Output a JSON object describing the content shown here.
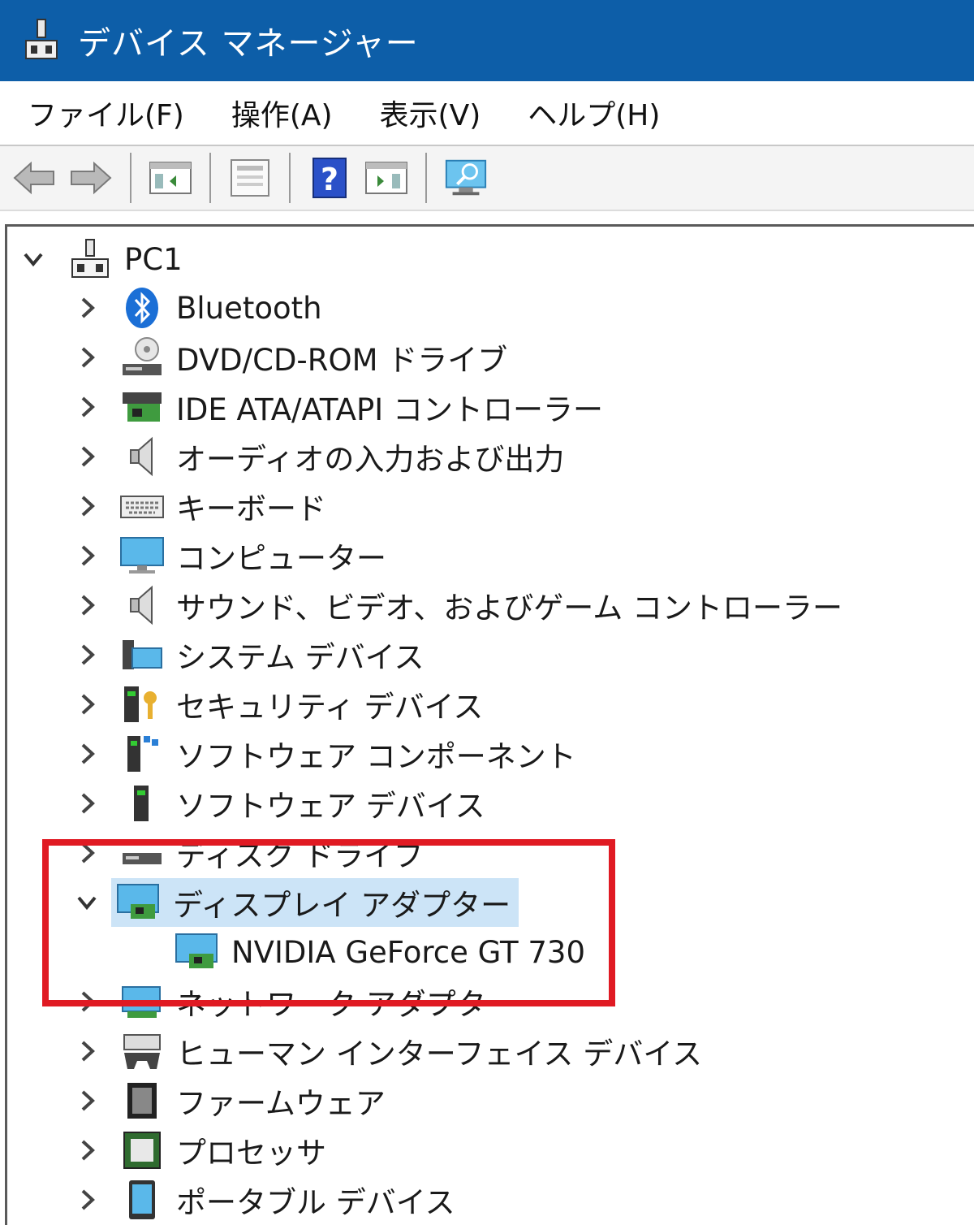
{
  "window": {
    "title": "デバイス マネージャー",
    "app_icon": "device-manager-icon"
  },
  "menu": [
    {
      "label": "ファイル(F)"
    },
    {
      "label": "操作(A)"
    },
    {
      "label": "表示(V)"
    },
    {
      "label": "ヘルプ(H)"
    }
  ],
  "toolbar": {
    "buttons": [
      "back-icon",
      "forward-icon",
      "show-hide-console-tree-icon",
      "properties-icon",
      "help-icon",
      "action-pane-icon",
      "scan-hardware-icon"
    ]
  },
  "tree": {
    "root": {
      "label": "PC1",
      "expanded": true,
      "icon": "computer-network-icon"
    },
    "items": [
      {
        "label": "Bluetooth",
        "icon": "bluetooth-icon"
      },
      {
        "label": "DVD/CD-ROM ドライブ",
        "icon": "dvd-drive-icon"
      },
      {
        "label": "IDE ATA/ATAPI コントローラー",
        "icon": "ide-controller-icon"
      },
      {
        "label": "オーディオの入力および出力",
        "icon": "speaker-icon"
      },
      {
        "label": "キーボード",
        "icon": "keyboard-icon"
      },
      {
        "label": "コンピューター",
        "icon": "monitor-icon"
      },
      {
        "label": "サウンド、ビデオ、およびゲーム コントローラー",
        "icon": "speaker-icon"
      },
      {
        "label": "システム デバイス",
        "icon": "system-devices-icon"
      },
      {
        "label": "セキュリティ デバイス",
        "icon": "security-device-icon"
      },
      {
        "label": "ソフトウェア コンポーネント",
        "icon": "software-component-icon"
      },
      {
        "label": "ソフトウェア デバイス",
        "icon": "software-device-icon"
      },
      {
        "label": "ディスク ドライブ",
        "icon": "disk-drive-icon"
      },
      {
        "label": "ディスプレイ アダプター",
        "icon": "display-adapter-icon",
        "expanded": true,
        "selected": true,
        "children": [
          {
            "label": "NVIDIA GeForce GT 730",
            "icon": "display-adapter-icon"
          }
        ]
      },
      {
        "label": "ネットワーク アダプター",
        "icon": "network-adapter-icon"
      },
      {
        "label": "ヒューマン インターフェイス デバイス",
        "icon": "hid-icon"
      },
      {
        "label": "ファームウェア",
        "icon": "firmware-icon"
      },
      {
        "label": "プロセッサ",
        "icon": "processor-icon"
      },
      {
        "label": "ポータブル デバイス",
        "icon": "portable-device-icon"
      }
    ]
  },
  "colors": {
    "titlebar": "#0d5ea8",
    "selection": "#cce4f7",
    "highlight_box": "#e01a23"
  }
}
